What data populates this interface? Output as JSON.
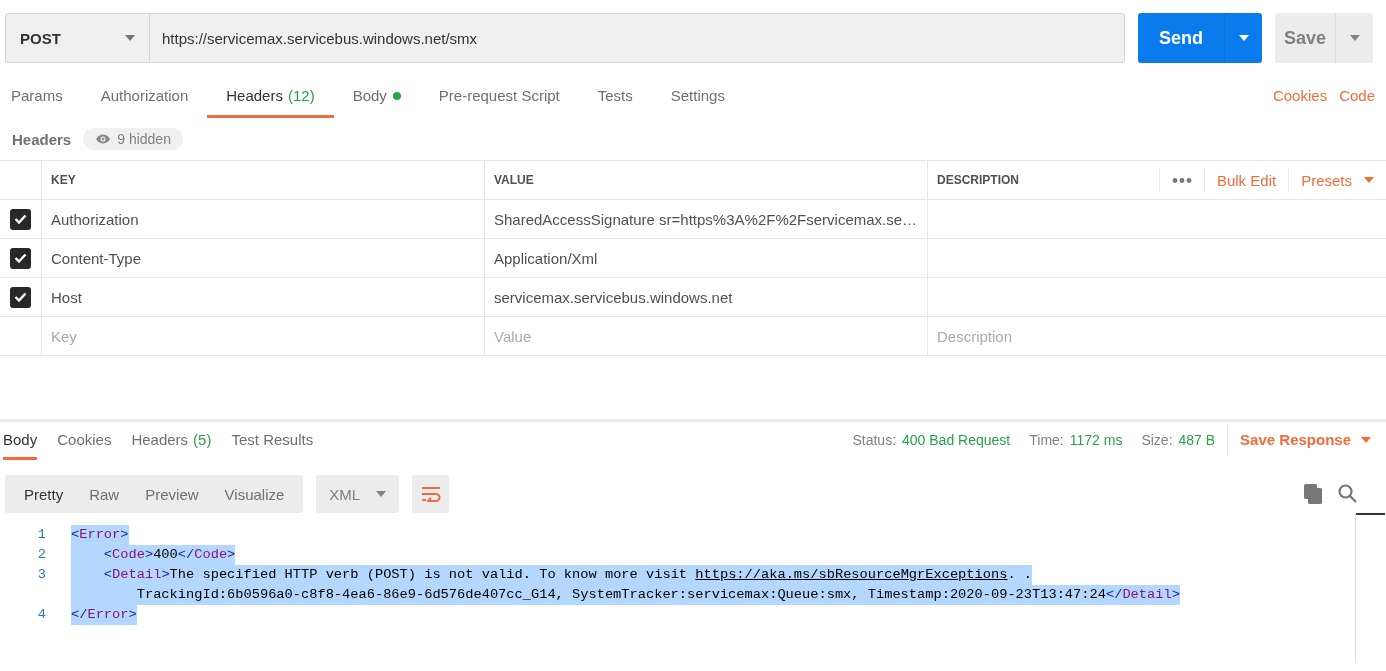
{
  "request": {
    "method": "POST",
    "url": "https://servicemax.servicebus.windows.net/smx",
    "send_label": "Send",
    "save_label": "Save"
  },
  "request_tabs": [
    {
      "label": "Params",
      "selected": false
    },
    {
      "label": "Authorization",
      "selected": false
    },
    {
      "label": "Headers",
      "count": "(12)",
      "selected": true
    },
    {
      "label": "Body",
      "dot": true,
      "selected": false
    },
    {
      "label": "Pre-request Script",
      "selected": false
    },
    {
      "label": "Tests",
      "selected": false
    },
    {
      "label": "Settings",
      "selected": false
    }
  ],
  "request_links": [
    "Cookies",
    "Code"
  ],
  "headers": {
    "title": "Headers",
    "hidden_badge": "9 hidden",
    "columns": [
      "KEY",
      "VALUE",
      "DESCRIPTION"
    ],
    "bulk_edit": "Bulk Edit",
    "presets": "Presets",
    "rows": [
      {
        "checked": true,
        "key": "Authorization",
        "value": "SharedAccessSignature sr=https%3A%2F%2Fservicemax.se…"
      },
      {
        "checked": true,
        "key": "Content-Type",
        "value": "Application/Xml"
      },
      {
        "checked": true,
        "key": "Host",
        "value": "servicemax.servicebus.windows.net"
      }
    ],
    "new_row": {
      "key_placeholder": "Key",
      "value_placeholder": "Value",
      "description_placeholder": "Description"
    }
  },
  "response": {
    "tabs": [
      {
        "label": "Body",
        "selected": true
      },
      {
        "label": "Cookies",
        "selected": false
      },
      {
        "label": "Headers",
        "count": "(5)",
        "selected": false
      },
      {
        "label": "Test Results",
        "selected": false
      }
    ],
    "stats": [
      {
        "label": "Status:",
        "value": "400 Bad Request"
      },
      {
        "label": "Time:",
        "value": "1172 ms"
      },
      {
        "label": "Size:",
        "value": "487 B"
      }
    ],
    "save_response": "Save Response",
    "views": [
      {
        "label": "Pretty",
        "selected": true
      },
      {
        "label": "Raw",
        "selected": false
      },
      {
        "label": "Preview",
        "selected": false
      },
      {
        "label": "Visualize",
        "selected": false
      }
    ],
    "format": "XML",
    "wrap_lines": true,
    "code_lines": [
      {
        "number": "1",
        "selected": true,
        "text": "<Error>"
      },
      {
        "number": "2",
        "selected": true,
        "text": "    <Code>400</Code>"
      },
      {
        "number": "3",
        "selected": true,
        "text": "    <Detail>The specified HTTP verb (POST) is not valid. To know more visit https://aka.ms/sbResourceMgrExceptions. ."
      },
      {
        "selected": true,
        "text": "        TrackingId:6b0596a0-c8f8-4ea6-86e9-6d576de407cc_G14, SystemTracker:servicemax:Queue:smx, Timestamp:2020-09-23T13:47:24</Detail>"
      },
      {
        "number": "4",
        "selected": true,
        "text": "</Error>"
      }
    ]
  }
}
